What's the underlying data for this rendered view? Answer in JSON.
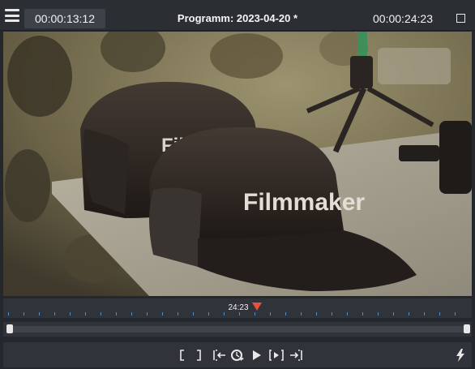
{
  "header": {
    "current_timecode": "00:00:13:12",
    "program_title": "Programm: 2023-04-20 *",
    "duration_timecode": "00:00:24:23"
  },
  "viewer": {
    "cap_text_front": "Filmmaker",
    "cap_text_back": "Filmmaker"
  },
  "timeline": {
    "playhead_time": "24:23"
  },
  "icons": {
    "menu": "hamburger-menu-icon",
    "window": "square-window-icon",
    "mark_in": "bracket-open-icon",
    "mark_out": "bracket-close-icon",
    "go_in": "jump-to-in-icon",
    "loop": "loop-icon",
    "play": "play-icon",
    "next_frame": "step-forward-icon",
    "go_out": "jump-to-out-icon",
    "lightning": "lightning-icon"
  },
  "colors": {
    "accent_playhead": "#e8503a",
    "tick": "#4a90d9"
  }
}
